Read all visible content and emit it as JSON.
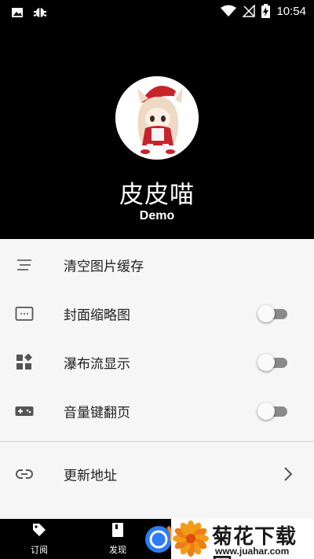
{
  "status_bar": {
    "time": "10:54",
    "left_icons": [
      "image-icon",
      "bug-icon"
    ],
    "right_icons": [
      "wifi-icon",
      "signal-icon",
      "battery-charging-icon"
    ]
  },
  "profile": {
    "name": "皮皮喵",
    "subtitle": "Demo"
  },
  "settings": {
    "items": [
      {
        "label": "清空图片缓存",
        "icon": "clear-icon",
        "control": "none"
      },
      {
        "label": "封面缩略图",
        "icon": "thumbnail-icon",
        "control": "toggle",
        "on": false
      },
      {
        "label": "瀑布流显示",
        "icon": "grid-icon",
        "control": "toggle",
        "on": false
      },
      {
        "label": "音量键翻页",
        "icon": "gamepad-icon",
        "control": "toggle",
        "on": false
      },
      {
        "label": "更新地址",
        "icon": "link-icon",
        "control": "chevron"
      }
    ]
  },
  "bottom_nav": {
    "items": [
      {
        "label": "订阅",
        "icon": "tag-icon"
      },
      {
        "label": "发现",
        "icon": "book-icon"
      }
    ]
  },
  "watermark": {
    "title": "菊花下载网",
    "url": "www.juahar.com"
  },
  "colors": {
    "header_bg": "#000000",
    "settings_bg": "#f6f6f6",
    "toggle_off_track": "#8a8a8a",
    "accent_ball": "#2d7cf6"
  }
}
